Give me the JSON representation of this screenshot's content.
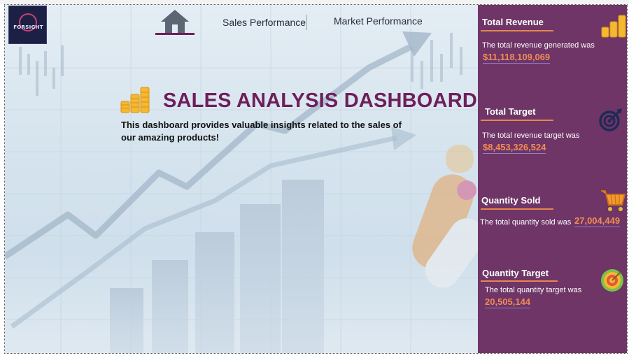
{
  "nav": {
    "home_label": "",
    "sales_performance": "Sales Performance",
    "market_performance": "Market Performance"
  },
  "logo": {
    "text": "FORSIGHT"
  },
  "hero": {
    "title": "SALES ANALYSIS DASHBOARD",
    "description": "This dashboard provides valuable insights related to the sales of our amazing products!"
  },
  "kpis": [
    {
      "title": "Total Revenue",
      "text": "The total revenue generated was",
      "value": "$11,118,109,069",
      "icon": "bar-coins-icon"
    },
    {
      "title": "Total Target",
      "text": "The total revenue target was",
      "value": "$8,453,326,524",
      "icon": "target-icon"
    },
    {
      "title": "Quantity Sold",
      "text": "The total quantity sold was",
      "value": "27,004,449",
      "icon": "cart-icon"
    },
    {
      "title": "Quantity Target",
      "text": "The total quantity target was",
      "value": "20,505,144",
      "icon": "dartboard-icon"
    }
  ],
  "colors": {
    "accent": "#6e1f5a",
    "panel": "#6e3566",
    "kpi_value": "#f28b55",
    "kpi_underline": "#e8874d",
    "coin": "#f5b82e"
  }
}
